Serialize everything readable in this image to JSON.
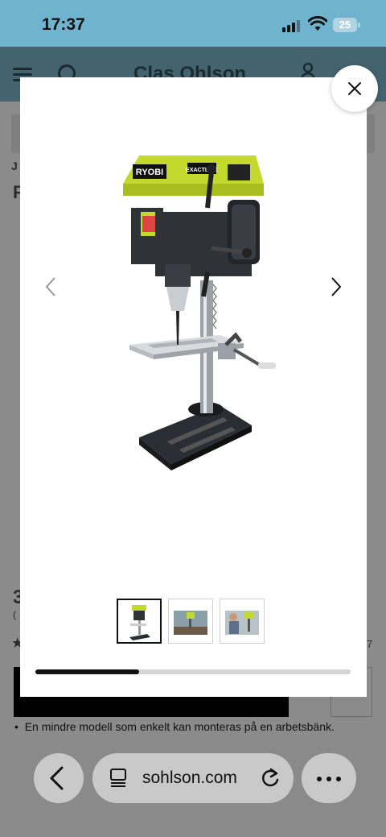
{
  "status_bar": {
    "time": "17:37",
    "battery": "25"
  },
  "site": {
    "logo": "Clas Ohlson",
    "fragments": {
      "left_a": "J",
      "left_b": "P",
      "price_fragment": "3",
      "price_sub": "(",
      "rating_left": "★",
      "rating_right": "7"
    },
    "buy_button_label": "",
    "bullet_text": "En mindre modell som enkelt kan monteras på en arbetsbänk."
  },
  "gallery": {
    "brand_label": "RYOBI",
    "feature_label": "EXACTLINE",
    "progress": 0.33,
    "thumbnails": [
      {
        "name": "drill-press-front",
        "active": true
      },
      {
        "name": "drill-press-workshop",
        "active": false
      },
      {
        "name": "drill-press-in-use",
        "active": false
      }
    ]
  },
  "browser": {
    "url": "sohlson.com"
  },
  "icons": {
    "close": "close-icon",
    "prev": "chevron-left-icon",
    "next": "chevron-right-icon",
    "back": "chevron-left-icon",
    "tabs": "tabs-icon",
    "reload": "reload-icon",
    "more": "more-icon"
  },
  "colors": {
    "status_bar": "#6fb3cf",
    "ryobi_green": "#c4d92d",
    "overlay": "#8a8a8a",
    "progress": "#111111"
  }
}
